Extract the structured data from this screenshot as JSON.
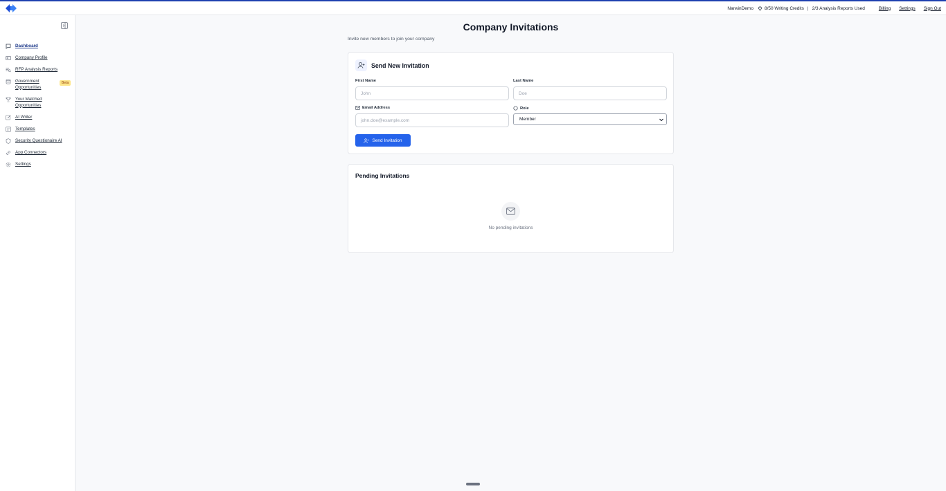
{
  "header": {
    "user": "NarwinDemo",
    "credits": "8/50 Writing Credits",
    "separator": "|",
    "reports": "2/3 Analysis Reports Used",
    "links": [
      "Billing",
      "Settings",
      "Sign Out"
    ]
  },
  "sidebar": {
    "items": [
      {
        "label": "Dashboard",
        "icon": "chat-icon"
      },
      {
        "label": "Company Profile",
        "icon": "id-card-icon"
      },
      {
        "label": "RFP Analysis Reports",
        "icon": "list-search-icon"
      },
      {
        "label": "Government Opportunities",
        "line1": "Government",
        "line2": "Opportunities",
        "icon": "database-icon",
        "badge": "Beta"
      },
      {
        "label": "Your Matched Opportunities",
        "line1": "Your Matched",
        "line2": "Opportunities",
        "icon": "trophy-icon"
      },
      {
        "label": "AI Writer",
        "icon": "pen-icon"
      },
      {
        "label": "Templates",
        "icon": "template-icon"
      },
      {
        "label": "Security Questionaire AI",
        "icon": "shield-icon"
      },
      {
        "label": "App Connectors",
        "icon": "link-icon"
      },
      {
        "label": "Settings",
        "icon": "gear-icon"
      }
    ]
  },
  "main": {
    "title": "Company Invitations",
    "subtitle": "Invite new members to join your company",
    "form": {
      "title": "Send New Invitation",
      "first_name_label": "First Name",
      "first_name_placeholder": "John",
      "last_name_label": "Last Name",
      "last_name_placeholder": "Doe",
      "email_label": "Email Address",
      "email_placeholder": "john.doe@example.com",
      "role_label": "Role",
      "role_value": "Member",
      "submit_label": "Send Invitation"
    },
    "pending": {
      "title": "Pending Invitations",
      "empty_text": "No pending invitations"
    }
  },
  "colors": {
    "accent": "#2563eb",
    "topline": "#1e40af",
    "beta_bg": "#fde68a"
  }
}
